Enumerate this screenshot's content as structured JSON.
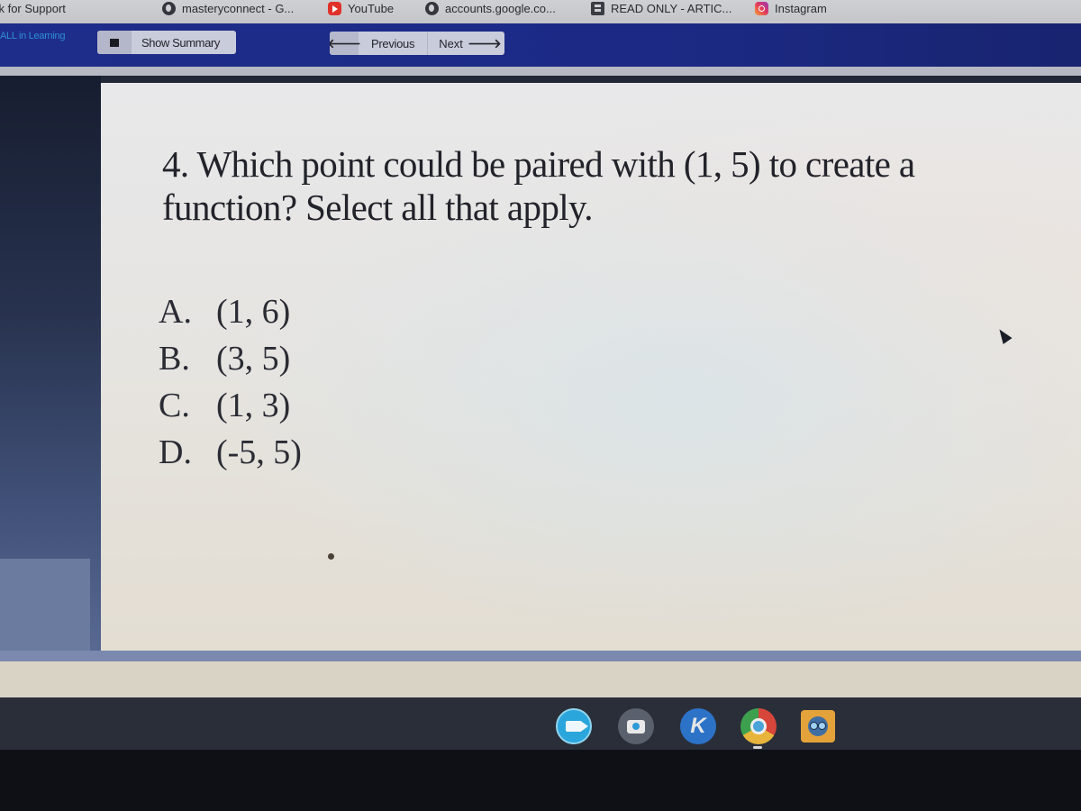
{
  "bookmarks": [
    {
      "label": "Remote Link for Support",
      "icon": "none"
    },
    {
      "label": "masteryconnect - G...",
      "icon": "globe-icon"
    },
    {
      "label": "YouTube",
      "icon": "youtube-icon"
    },
    {
      "label": "accounts.google.co...",
      "icon": "globe-icon"
    },
    {
      "label": "READ ONLY - ARTIC...",
      "icon": "document-icon"
    },
    {
      "label": "Instagram",
      "icon": "instagram-icon"
    }
  ],
  "toolbar": {
    "brand": "ALL in Learning",
    "show_summary_label": "Show Summary",
    "previous_label": "Previous",
    "next_label": "Next",
    "prev_arrow": "🡐",
    "next_arrow": "🡒"
  },
  "question": {
    "number": "4.",
    "text": "4. Which point could be paired with (1, 5) to create a function? Select all that apply.",
    "choices": [
      {
        "letter": "A.",
        "value": "(1, 6)"
      },
      {
        "letter": "B.",
        "value": "(3, 5)"
      },
      {
        "letter": "C.",
        "value": "(1, 3)"
      },
      {
        "letter": "D.",
        "value": "(-5, 5)"
      }
    ]
  },
  "shelf": {
    "apps": [
      {
        "name": "Zoom",
        "icon": "zoom-video-icon"
      },
      {
        "name": "Camera",
        "icon": "camera-icon"
      },
      {
        "name": "Kami",
        "icon": "kami-icon",
        "glyph": "K"
      },
      {
        "name": "Chrome",
        "icon": "chrome-icon",
        "active": true
      },
      {
        "name": "Game",
        "icon": "game-character-icon"
      }
    ]
  },
  "colors": {
    "toolbar_navy": "#1e2d8a",
    "brand_text": "#2f8fd2",
    "button_bg": "#c9ccdb",
    "content_bg": "#e6e4e0",
    "shelf_bg": "#2a2e39"
  }
}
